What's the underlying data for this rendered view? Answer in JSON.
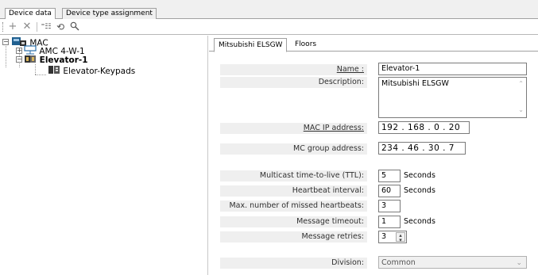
{
  "top_tabs": [
    {
      "label": "Device data",
      "active": true
    },
    {
      "label": "Device type assignment",
      "active": false
    }
  ],
  "toolbar": {
    "icons": [
      "add-icon",
      "delete-icon",
      "properties-icon",
      "refresh-icon",
      "search-icon"
    ]
  },
  "tree": {
    "root": {
      "label": "MAC",
      "icon": "mac-icon"
    },
    "children": [
      {
        "label": "AMC 4-W-1",
        "icon": "controller-icon",
        "bold": false
      },
      {
        "label": "Elevator-1",
        "icon": "elevator-icon",
        "bold": true,
        "children": [
          {
            "label": "Elevator-Keypads",
            "icon": "keypad-icon"
          }
        ]
      }
    ]
  },
  "detail_tabs": [
    {
      "label": "Mitsubishi ELSGW",
      "active": true
    },
    {
      "label": "Floors",
      "active": false
    }
  ],
  "form": {
    "name_label": "Name :",
    "name_value": "Elevator-1",
    "description_label": "Description:",
    "description_value": "Mitsubishi ELSGW",
    "mac_ip_label": "MAC IP address:",
    "mac_ip_value": "192 . 168 .  0  . 20",
    "mc_group_label": "MC group address:",
    "mc_group_value": "234 . 46 . 30 . 7",
    "ttl_label": "Multicast time-to-live (TTL):",
    "ttl_value": "5",
    "ttl_unit": "Seconds",
    "heartbeat_label": "Heartbeat interval:",
    "heartbeat_value": "60",
    "heartbeat_unit": "Seconds",
    "missed_label": "Max. number of missed heartbeats:",
    "missed_value": "3",
    "timeout_label": "Message timeout:",
    "timeout_value": "1",
    "timeout_unit": "Seconds",
    "retries_label": "Message retries:",
    "retries_value": "3",
    "division_label": "Division:",
    "division_value": "Common"
  }
}
